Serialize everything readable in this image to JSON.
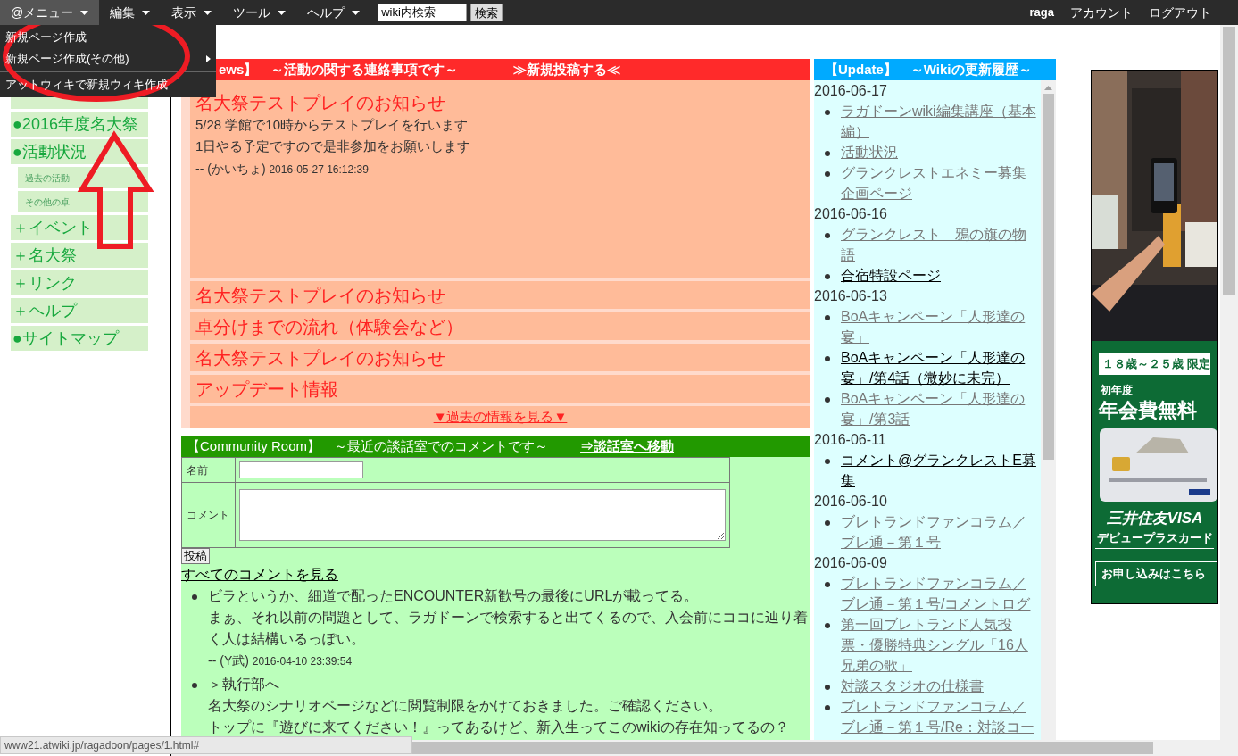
{
  "menubar": {
    "items": [
      {
        "label": "@メニュー",
        "selected": true
      },
      {
        "label": "編集",
        "selected": false
      },
      {
        "label": "表示",
        "selected": false
      },
      {
        "label": "ツール",
        "selected": false
      },
      {
        "label": "ヘルプ",
        "selected": false
      }
    ],
    "search": {
      "value": "wiki内検索"
    },
    "search_button": "検索",
    "user": "raga",
    "links": [
      "アカウント",
      "ログアウト"
    ]
  },
  "dropdown": {
    "items": [
      {
        "label": "新規ページ作成",
        "submenu": false,
        "divider_before": false
      },
      {
        "label": "新規ページ作成(その他)",
        "submenu": true,
        "divider_before": false
      },
      {
        "label": "アットウィキで新規ウィキ作成",
        "submenu": false,
        "divider_before": true
      }
    ]
  },
  "sidebar": {
    "items": [
      {
        "label": "●2016年度名大祭"
      },
      {
        "label": "●活動状況",
        "children": [
          {
            "label": "過去の活動"
          },
          {
            "label": "その他の卓"
          }
        ]
      },
      {
        "label": "＋イベント"
      },
      {
        "label": "＋名大祭"
      },
      {
        "label": "＋リンク"
      },
      {
        "label": "＋ヘルプ"
      },
      {
        "label": "●サイトマップ"
      }
    ]
  },
  "news": {
    "title": "ews】　～活動の関する連絡事項です～",
    "post_link": "≫新規投稿する≪",
    "featured": {
      "title": "名大祭テストプレイのお知らせ",
      "lines": [
        "5/28 学館で10時からテストプレイを行います",
        "1日やる予定ですので是非参加をお願いします"
      ],
      "author": "-- (かいちょ)",
      "timestamp": "2016-05-27 16:12:39"
    },
    "items": [
      "名大祭テストプレイのお知らせ",
      "卓分けまでの流れ（体験会など）",
      "名大祭テストプレイのお知らせ",
      "アップデート情報"
    ],
    "more_link": "▼過去の情報を見る▼"
  },
  "community": {
    "title": "【Community Room】　～最近の談話室でのコメントです～",
    "move_link": "⇒談話室へ移動",
    "form": {
      "name_label": "名前",
      "comment_label": "コメント",
      "submit": "投稿"
    },
    "all_link": "すべてのコメントを見る",
    "comments": [
      {
        "lines": [
          "ビラというか、細道で配ったENCOUNTER新歓号の最後にURLが載ってる。",
          "まぁ、それ以前の問題として、ラガドーンで検索すると出てくるので、入会前にココに辿り着く人は結構いるっぽい。"
        ],
        "author": "-- (Y武)",
        "timestamp": "2016-04-10 23:39:54"
      },
      {
        "lines": [
          "＞執行部へ",
          "名大祭のシナリオページなどに閲覧制限をかけておきました。ご確認ください。",
          "トップに『遊びに来てください！』ってあるけど、新入生ってこのwikiの存在知ってるの？"
        ]
      }
    ]
  },
  "update": {
    "title": "【Update】　～Wikiの更新履歴～",
    "groups": [
      {
        "date": "2016-06-17",
        "entries": [
          {
            "label": "ラガドーンwiki編集講座（基本編）",
            "visited": true
          },
          {
            "label": "活動状況",
            "visited": true
          },
          {
            "label": "グランクレストエネミー募集企画ページ",
            "visited": true
          }
        ]
      },
      {
        "date": "2016-06-16",
        "entries": [
          {
            "label": "グランクレスト　鴉の旗の物語",
            "visited": true
          },
          {
            "label": "合宿特設ページ",
            "visited": false
          }
        ]
      },
      {
        "date": "2016-06-13",
        "entries": [
          {
            "label": "BoAキャンペーン「人形達の宴」",
            "visited": true
          },
          {
            "label": "BoAキャンペーン「人形達の宴」/第4話（微妙に未完）",
            "visited": false
          },
          {
            "label": "BoAキャンペーン「人形達の宴」/第3話",
            "visited": true
          }
        ]
      },
      {
        "date": "2016-06-11",
        "entries": [
          {
            "label": "コメント@グランクレストE募集",
            "visited": false
          }
        ]
      },
      {
        "date": "2016-06-10",
        "entries": [
          {
            "label": "ブレトランドファンコラム／ブレ通－第１号",
            "visited": true
          }
        ]
      },
      {
        "date": "2016-06-09",
        "entries": [
          {
            "label": "ブレトランドファンコラム／ブレ通－第１号/コメントログ",
            "visited": true
          },
          {
            "label": "第一回ブレトランド人気投票・優勝特典シングル「16人兄弟の歌」",
            "visited": true
          },
          {
            "label": "対談スタジオの仕様書",
            "visited": true
          },
          {
            "label": "ブレトランドファンコラム／ブレ通－第１号/Re：対談コー",
            "visited": true
          }
        ]
      }
    ]
  },
  "ad": {
    "badge": "１８歳～２５歳 限定",
    "line1": "初年度",
    "headline": "年会費無料",
    "brand": "三井住友VISA",
    "product": "デビュープラスカード",
    "cta": "お申し込みはこちら"
  },
  "status_url": "www21.atwiki.jp/ragadoon/pages/1.html#",
  "annotations": [
    {
      "kind": "ellipse"
    },
    {
      "kind": "arrow"
    }
  ]
}
